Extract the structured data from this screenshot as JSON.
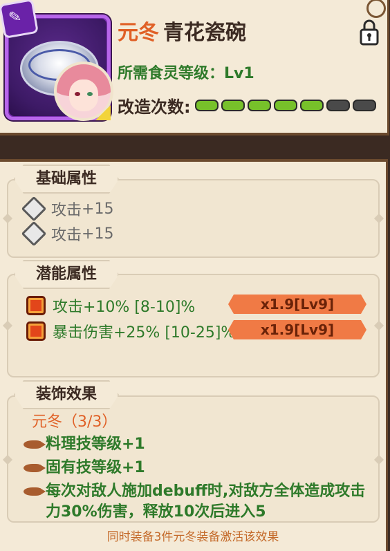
{
  "item": {
    "title_prefix": "元冬",
    "title_name": "青花瓷碗",
    "required_level_label": "所需食灵等级：",
    "required_level_value": "Lv1",
    "modify_label": "改造次数:",
    "modify_pips": [
      true,
      true,
      true,
      true,
      true,
      false,
      false
    ],
    "rarity_color": "#7a2fb0",
    "lock_icon": "lock-icon",
    "badge_icon": "spatula-icon"
  },
  "base_section": {
    "tab_label": "基础属性",
    "stats": [
      {
        "label": "攻击",
        "value": "+15"
      },
      {
        "label": "攻击",
        "value": "+15"
      }
    ]
  },
  "potential_section": {
    "tab_label": "潜能属性",
    "stats": [
      {
        "label": "攻击+10% [8-10]%",
        "multiplier": "x1.9[Lv9]"
      },
      {
        "label": "暴击伤害+25%  [10-25]%",
        "multiplier": "x1.9[Lv9]"
      }
    ]
  },
  "decor_section": {
    "tab_label": "装饰效果",
    "set_name": "元冬（3/3）",
    "effects": [
      "料理技等级+1",
      "固有技等级+1",
      "每次对敌人施加debuff时,对敌方全体造成攻击力30%伤害，释放10次后进入5"
    ],
    "footer": "同时装备3件元冬装备激活该效果"
  },
  "colors": {
    "accent_orange": "#e06026",
    "effect_green": "#2e7a2a",
    "multiplier_tag": "#f07a45",
    "pip_on": "#77c12a"
  }
}
